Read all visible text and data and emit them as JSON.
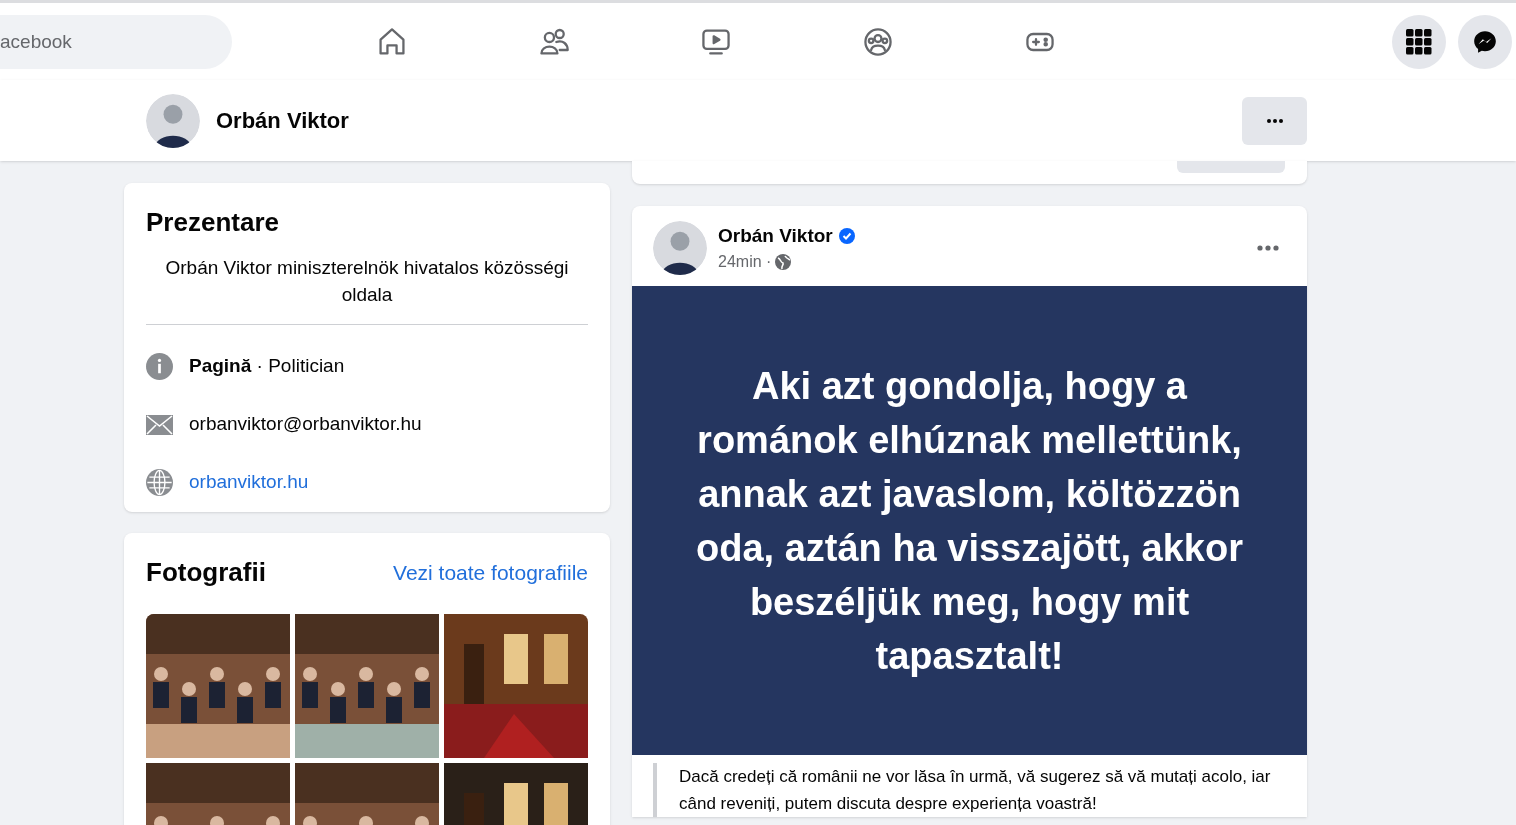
{
  "topbar": {
    "search": {
      "placeholder": "acebook"
    }
  },
  "page_header": {
    "name": "Orbán Viktor"
  },
  "intro": {
    "title": "Prezentare",
    "bio": "Orbán Viktor miniszterelnök hivatalos közösségi oldala",
    "details": [
      {
        "kind": "info",
        "text": "**Pagină** · Politician"
      },
      {
        "kind": "email",
        "text": "orbanviktor@orbanviktor.hu"
      },
      {
        "kind": "website",
        "text": "orbanviktor.hu"
      }
    ]
  },
  "photos": {
    "title": "Fotografii",
    "link": "Vezi toate fotografiile"
  },
  "post": {
    "author": "Orbán Viktor",
    "verified": true,
    "time": "24min ·",
    "quote": "Aki azt gondolja, hogy a románok elhúznak mellettünk, annak azt javaslom, költözzön oda, aztán ha visszajött, akkor beszéljük meg, hogy mit tapasztalt!",
    "caption": "Dacă credeți că românii ne vor lăsa în urmă, vă sugerez să vă mutați acolo, iar când reveniți, putem discuta despre experiența voastră!"
  }
}
